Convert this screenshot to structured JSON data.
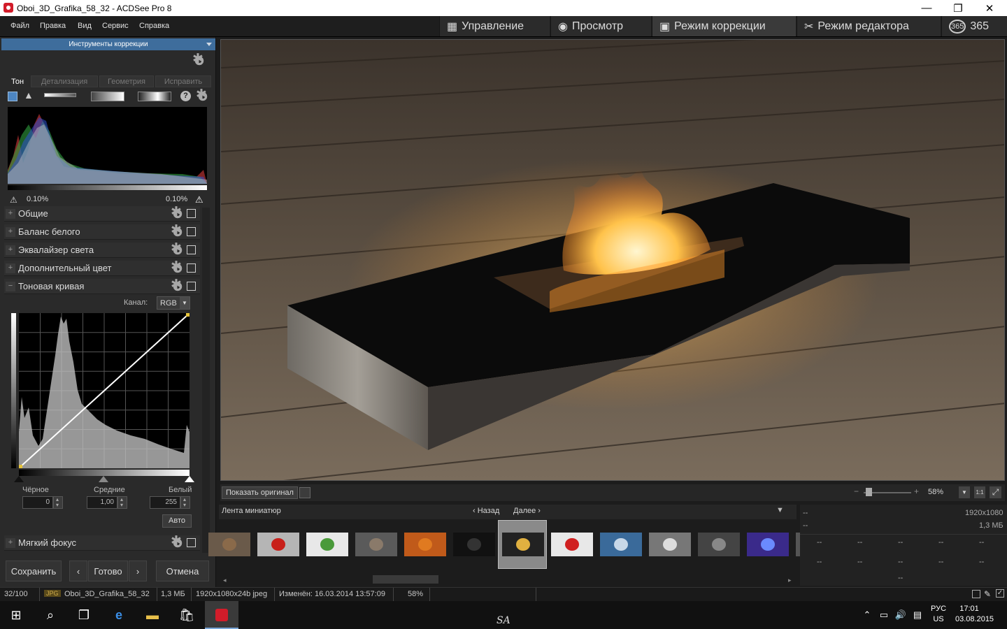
{
  "window": {
    "title": "Oboi_3D_Grafika_58_32 - ACDSee Pro 8",
    "min": "—",
    "max": "❐",
    "close": "✕"
  },
  "menu": [
    "Файл",
    "Правка",
    "Вид",
    "Сервис",
    "Справка"
  ],
  "modes": [
    {
      "label": "Управление",
      "icon": "grid-icon"
    },
    {
      "label": "Просмотр",
      "icon": "eye-icon"
    },
    {
      "label": "Режим коррекции",
      "icon": "photo-icon",
      "active": true
    },
    {
      "label": "Режим редактора",
      "icon": "tools-icon"
    },
    {
      "label": "365",
      "icon": "365-icon"
    }
  ],
  "panel": {
    "header": "Инструменты коррекции",
    "tabs": [
      "Тон",
      "Детализация",
      "Геометрия",
      "Исправить"
    ],
    "histogram": {
      "left_clip": "0.10%",
      "right_clip": "0.10%"
    },
    "sections": [
      "Общие",
      "Баланс белого",
      "Эквалайзер света",
      "Дополнительный цвет",
      "Тоновая кривая"
    ],
    "curve": {
      "channel_label": "Канал:",
      "channel_value": "RGB"
    },
    "levels": {
      "black_label": "Чёрное",
      "black_value": "0",
      "mid_label": "Средние",
      "mid_value": "1,00",
      "white_label": "Белый",
      "white_value": "255",
      "auto": "Авто"
    },
    "soft_focus": "Мягкий фокус",
    "buttons": {
      "save": "Сохранить",
      "done": "Готово",
      "cancel": "Отмена",
      "prev": "‹",
      "next": "›"
    }
  },
  "viewer": {
    "show_original": "Показать оригинал",
    "zoom": "58%",
    "fit": "1:1"
  },
  "filmstrip": {
    "title": "Лента миниатюр",
    "back": "Назад",
    "forward": "Далее",
    "thumb_count": 13,
    "selected_index": 6
  },
  "info": {
    "row1_left": "--",
    "row1_right": "1920x1080",
    "row2_left": "--",
    "row2_right": "1,3 МБ",
    "grid": [
      "--",
      "--",
      "--",
      "--",
      "--",
      "--",
      "--",
      "--",
      "--",
      "--"
    ],
    "last": "--"
  },
  "status": {
    "count": "32/100",
    "type": "JPG",
    "filename": "Oboi_3D_Grafika_58_32",
    "size": "1,3 МБ",
    "dims": "1920x1080x24b jpeg",
    "modified": "Изменён: 16.03.2014 13:57:09",
    "zoom": "58%"
  },
  "taskbar": {
    "watermark": "SA",
    "lang_top": "РУС",
    "lang_bottom": "US",
    "time": "17:01",
    "date": "03.08.2015"
  },
  "colors": {
    "accent": "#3e6d9c",
    "selected_thumb": "#8a8a8a",
    "flame": "#ff9a2a"
  }
}
